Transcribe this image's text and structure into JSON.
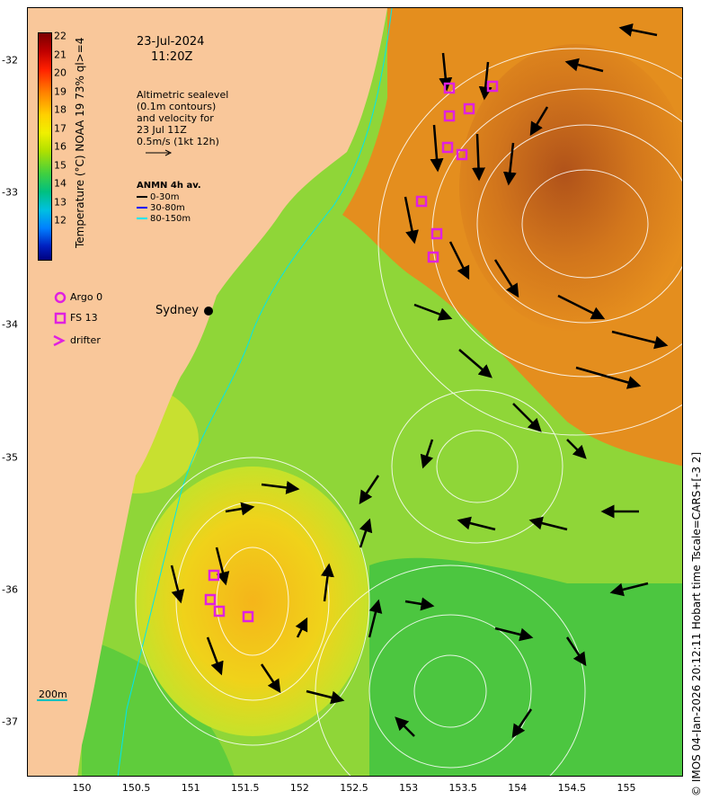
{
  "header": {
    "date": "23-Jul-2024",
    "time": "11:20Z"
  },
  "altimetry_note": "Altimetric sealevel\n(0.1m contours)\nand velocity for\n23 Jul 11Z\n0.5m/s (1kt 12h)",
  "anmn": {
    "title": "ANMN 4h av.",
    "rows": [
      {
        "label": "0-30m",
        "color": "#000000"
      },
      {
        "label": "30-80m",
        "color": "#0000ff"
      },
      {
        "label": "80-150m",
        "color": "#00e5ee"
      }
    ]
  },
  "colorbar": {
    "title": "Temperature (°C) NOAA 19 73% ql>=4",
    "ticks": [
      "22",
      "21",
      "20",
      "19",
      "18",
      "17",
      "16",
      "15",
      "14",
      "13",
      "12"
    ]
  },
  "legend": {
    "argo": "Argo 0",
    "fs": "FS 13",
    "drifter": "drifter"
  },
  "city": "Sydney",
  "depth_label": "200m",
  "axes": {
    "lon_ticks": [
      "150",
      "150.5",
      "151",
      "151.5",
      "152",
      "152.5",
      "153",
      "153.5",
      "154",
      "154.5",
      "155"
    ],
    "lat_ticks": [
      "-32",
      "-33",
      "-34",
      "-35",
      "-36",
      "-37"
    ]
  },
  "copyright": "© IMOS 04-Jan-2026 20:12:11 Hobart time Tscale=CARS+[-3 2]",
  "colors": {
    "land": "#f9c79a",
    "cool_water": "#7ed330",
    "warm_water": "#e08a1e",
    "marker": "#e020e0"
  }
}
